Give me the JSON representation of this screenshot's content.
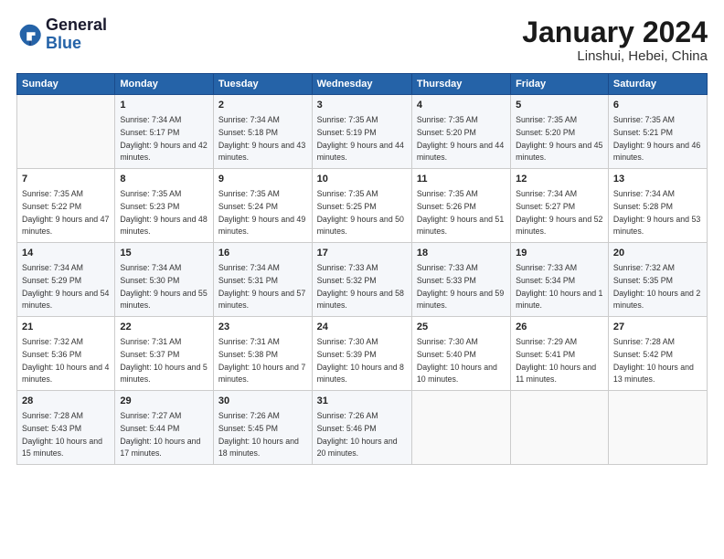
{
  "logo": {
    "line1": "General",
    "line2": "Blue"
  },
  "title": "January 2024",
  "subtitle": "Linshui, Hebei, China",
  "weekdays": [
    "Sunday",
    "Monday",
    "Tuesday",
    "Wednesday",
    "Thursday",
    "Friday",
    "Saturday"
  ],
  "weeks": [
    [
      {
        "day": "",
        "sunrise": "",
        "sunset": "",
        "daylight": ""
      },
      {
        "day": "1",
        "sunrise": "Sunrise: 7:34 AM",
        "sunset": "Sunset: 5:17 PM",
        "daylight": "Daylight: 9 hours and 42 minutes."
      },
      {
        "day": "2",
        "sunrise": "Sunrise: 7:34 AM",
        "sunset": "Sunset: 5:18 PM",
        "daylight": "Daylight: 9 hours and 43 minutes."
      },
      {
        "day": "3",
        "sunrise": "Sunrise: 7:35 AM",
        "sunset": "Sunset: 5:19 PM",
        "daylight": "Daylight: 9 hours and 44 minutes."
      },
      {
        "day": "4",
        "sunrise": "Sunrise: 7:35 AM",
        "sunset": "Sunset: 5:20 PM",
        "daylight": "Daylight: 9 hours and 44 minutes."
      },
      {
        "day": "5",
        "sunrise": "Sunrise: 7:35 AM",
        "sunset": "Sunset: 5:20 PM",
        "daylight": "Daylight: 9 hours and 45 minutes."
      },
      {
        "day": "6",
        "sunrise": "Sunrise: 7:35 AM",
        "sunset": "Sunset: 5:21 PM",
        "daylight": "Daylight: 9 hours and 46 minutes."
      }
    ],
    [
      {
        "day": "7",
        "sunrise": "Sunrise: 7:35 AM",
        "sunset": "Sunset: 5:22 PM",
        "daylight": "Daylight: 9 hours and 47 minutes."
      },
      {
        "day": "8",
        "sunrise": "Sunrise: 7:35 AM",
        "sunset": "Sunset: 5:23 PM",
        "daylight": "Daylight: 9 hours and 48 minutes."
      },
      {
        "day": "9",
        "sunrise": "Sunrise: 7:35 AM",
        "sunset": "Sunset: 5:24 PM",
        "daylight": "Daylight: 9 hours and 49 minutes."
      },
      {
        "day": "10",
        "sunrise": "Sunrise: 7:35 AM",
        "sunset": "Sunset: 5:25 PM",
        "daylight": "Daylight: 9 hours and 50 minutes."
      },
      {
        "day": "11",
        "sunrise": "Sunrise: 7:35 AM",
        "sunset": "Sunset: 5:26 PM",
        "daylight": "Daylight: 9 hours and 51 minutes."
      },
      {
        "day": "12",
        "sunrise": "Sunrise: 7:34 AM",
        "sunset": "Sunset: 5:27 PM",
        "daylight": "Daylight: 9 hours and 52 minutes."
      },
      {
        "day": "13",
        "sunrise": "Sunrise: 7:34 AM",
        "sunset": "Sunset: 5:28 PM",
        "daylight": "Daylight: 9 hours and 53 minutes."
      }
    ],
    [
      {
        "day": "14",
        "sunrise": "Sunrise: 7:34 AM",
        "sunset": "Sunset: 5:29 PM",
        "daylight": "Daylight: 9 hours and 54 minutes."
      },
      {
        "day": "15",
        "sunrise": "Sunrise: 7:34 AM",
        "sunset": "Sunset: 5:30 PM",
        "daylight": "Daylight: 9 hours and 55 minutes."
      },
      {
        "day": "16",
        "sunrise": "Sunrise: 7:34 AM",
        "sunset": "Sunset: 5:31 PM",
        "daylight": "Daylight: 9 hours and 57 minutes."
      },
      {
        "day": "17",
        "sunrise": "Sunrise: 7:33 AM",
        "sunset": "Sunset: 5:32 PM",
        "daylight": "Daylight: 9 hours and 58 minutes."
      },
      {
        "day": "18",
        "sunrise": "Sunrise: 7:33 AM",
        "sunset": "Sunset: 5:33 PM",
        "daylight": "Daylight: 9 hours and 59 minutes."
      },
      {
        "day": "19",
        "sunrise": "Sunrise: 7:33 AM",
        "sunset": "Sunset: 5:34 PM",
        "daylight": "Daylight: 10 hours and 1 minute."
      },
      {
        "day": "20",
        "sunrise": "Sunrise: 7:32 AM",
        "sunset": "Sunset: 5:35 PM",
        "daylight": "Daylight: 10 hours and 2 minutes."
      }
    ],
    [
      {
        "day": "21",
        "sunrise": "Sunrise: 7:32 AM",
        "sunset": "Sunset: 5:36 PM",
        "daylight": "Daylight: 10 hours and 4 minutes."
      },
      {
        "day": "22",
        "sunrise": "Sunrise: 7:31 AM",
        "sunset": "Sunset: 5:37 PM",
        "daylight": "Daylight: 10 hours and 5 minutes."
      },
      {
        "day": "23",
        "sunrise": "Sunrise: 7:31 AM",
        "sunset": "Sunset: 5:38 PM",
        "daylight": "Daylight: 10 hours and 7 minutes."
      },
      {
        "day": "24",
        "sunrise": "Sunrise: 7:30 AM",
        "sunset": "Sunset: 5:39 PM",
        "daylight": "Daylight: 10 hours and 8 minutes."
      },
      {
        "day": "25",
        "sunrise": "Sunrise: 7:30 AM",
        "sunset": "Sunset: 5:40 PM",
        "daylight": "Daylight: 10 hours and 10 minutes."
      },
      {
        "day": "26",
        "sunrise": "Sunrise: 7:29 AM",
        "sunset": "Sunset: 5:41 PM",
        "daylight": "Daylight: 10 hours and 11 minutes."
      },
      {
        "day": "27",
        "sunrise": "Sunrise: 7:28 AM",
        "sunset": "Sunset: 5:42 PM",
        "daylight": "Daylight: 10 hours and 13 minutes."
      }
    ],
    [
      {
        "day": "28",
        "sunrise": "Sunrise: 7:28 AM",
        "sunset": "Sunset: 5:43 PM",
        "daylight": "Daylight: 10 hours and 15 minutes."
      },
      {
        "day": "29",
        "sunrise": "Sunrise: 7:27 AM",
        "sunset": "Sunset: 5:44 PM",
        "daylight": "Daylight: 10 hours and 17 minutes."
      },
      {
        "day": "30",
        "sunrise": "Sunrise: 7:26 AM",
        "sunset": "Sunset: 5:45 PM",
        "daylight": "Daylight: 10 hours and 18 minutes."
      },
      {
        "day": "31",
        "sunrise": "Sunrise: 7:26 AM",
        "sunset": "Sunset: 5:46 PM",
        "daylight": "Daylight: 10 hours and 20 minutes."
      },
      {
        "day": "",
        "sunrise": "",
        "sunset": "",
        "daylight": ""
      },
      {
        "day": "",
        "sunrise": "",
        "sunset": "",
        "daylight": ""
      },
      {
        "day": "",
        "sunrise": "",
        "sunset": "",
        "daylight": ""
      }
    ]
  ]
}
